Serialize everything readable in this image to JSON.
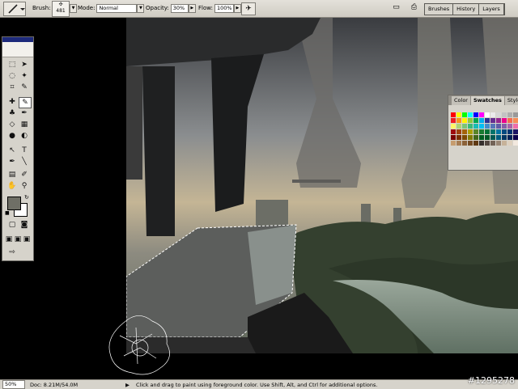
{
  "options_bar": {
    "brush_label": "Brush:",
    "brush_size": "481",
    "mode_label": "Mode:",
    "mode_value": "Normal",
    "opacity_label": "Opacity:",
    "opacity_value": "30%",
    "flow_label": "Flow:",
    "flow_value": "100%"
  },
  "palette_tabs": [
    "Brushes",
    "History",
    "Layers"
  ],
  "swatches_panel": {
    "tabs": [
      "Color",
      "Swatches",
      "Styles"
    ]
  },
  "status_bar": {
    "zoom": "50%",
    "doc_info": "Doc: 8.21M/54.0M",
    "hint": "Click and drag to paint using foreground color.  Use Shift, Alt, and Ctrl for additional options."
  },
  "watermark": "#1295278",
  "colors": {
    "foreground": "#6f6f66",
    "background": "#ffffff",
    "selection_border": "#ffffff"
  },
  "swatch_colors": [
    "#ff0000",
    "#ffff00",
    "#00ff00",
    "#00ffff",
    "#0000ff",
    "#ff00ff",
    "#ffffff",
    "#ebebeb",
    "#d6d6d6",
    "#c2c2c2",
    "#adadad",
    "#999999",
    "#858585",
    "#ed1c24",
    "#f7941d",
    "#fff200",
    "#8dc63f",
    "#00a651",
    "#00aeef",
    "#2e3192",
    "#662d91",
    "#92278f",
    "#ec008c",
    "#f26c4f",
    "#f68e56",
    "#fbaf5c",
    "#fff568",
    "#acd373",
    "#7cc576",
    "#3bb878",
    "#1abbb4",
    "#00bff3",
    "#438ccb",
    "#5574b9",
    "#605ca8",
    "#855fa8",
    "#a763a8",
    "#f06eaa",
    "#f49ac1",
    "#9e0b0f",
    "#a0410d",
    "#a36209",
    "#aba000",
    "#598527",
    "#1a7b30",
    "#007236",
    "#00746b",
    "#0076a3",
    "#004a80",
    "#003471",
    "#1b1464",
    "#440e62",
    "#790000",
    "#7b2e00",
    "#7d4900",
    "#827b00",
    "#406618",
    "#005e20",
    "#005826",
    "#005952",
    "#005b7f",
    "#003663",
    "#002157",
    "#0d004c",
    "#32004b",
    "#c69c6e",
    "#a67c52",
    "#8c6239",
    "#754c24",
    "#603913",
    "#362f2d",
    "#534741",
    "#736357",
    "#998675",
    "#c7b299",
    "#ded0bf",
    "#f2e8de",
    "#ffffff"
  ]
}
